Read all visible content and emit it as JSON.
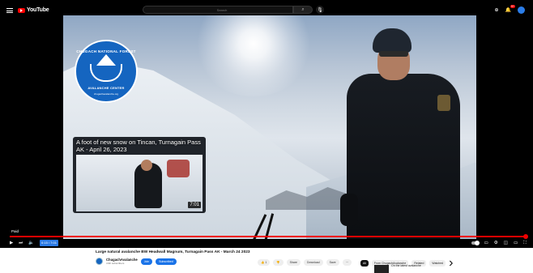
{
  "topbar": {
    "logo_text": "YouTube",
    "search_placeholder": "Search",
    "notification_count": "9+"
  },
  "overlay": {
    "logo_top": "CHUGACH NATIONAL FOREST",
    "logo_bottom": "AVALANCHE CENTER",
    "logo_url": "chugachavalanche.org"
  },
  "endcard": {
    "title": "A foot of new snow on Tincan, Turnagain Pass AK - April 26, 2023",
    "duration": "7:01"
  },
  "player": {
    "chip": "Paid",
    "time": "0:15 / 7:01",
    "progress": 1.0
  },
  "video": {
    "title": "Large natural avalanche BW Headwall Magnum, Turnagain Pass AK - March 24 2023",
    "channel": "ChugachAvalanche",
    "subscribers": "4.9K subscribers",
    "join_label": "Join",
    "subscribe_label": "Subscribed",
    "like_count": "1",
    "share_label": "Share",
    "download_label": "Download",
    "save_label": "Save"
  },
  "recommendations": {
    "chips": [
      "All",
      "From ChugachAvalanche",
      "Related",
      "Watched"
    ],
    "first_title": "On the latest avalanche"
  },
  "colors": {
    "accent": "#ff0000",
    "brand_blue": "#1565c0",
    "time_highlight": "#2c7be5"
  }
}
